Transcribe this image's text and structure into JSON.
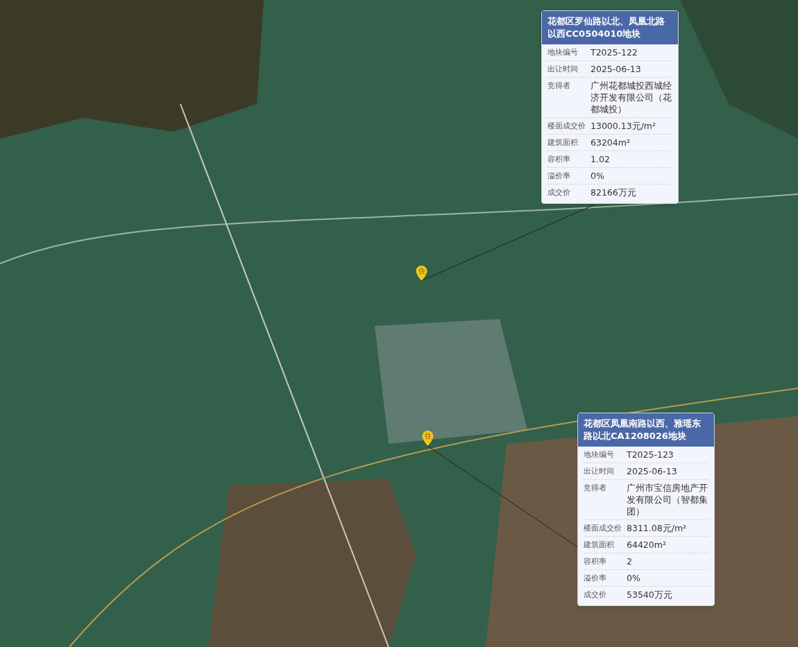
{
  "map": {
    "pins": [
      {
        "label": "住"
      },
      {
        "label": "住"
      }
    ]
  },
  "popups": [
    {
      "title": "花都区罗仙路以北、凤凰北路以西CC0504010地块",
      "fields": [
        {
          "label": "地块编号",
          "value": "T2025-122"
        },
        {
          "label": "出让时间",
          "value": "2025-06-13"
        },
        {
          "label": "竞得者",
          "value": "广州花都城投西城经济开发有限公司（花都城投）"
        },
        {
          "label": "楼面成交价",
          "value": "13000.13元/m²"
        },
        {
          "label": "建筑面积",
          "value": "63204m²"
        },
        {
          "label": "容积率",
          "value": "1.02"
        },
        {
          "label": "溢价率",
          "value": "0%"
        },
        {
          "label": "成交价",
          "value": "82166万元"
        }
      ]
    },
    {
      "title": "花都区凤凰南路以西、雅瑶东路以北CA1208026地块",
      "fields": [
        {
          "label": "地块编号",
          "value": "T2025-123"
        },
        {
          "label": "出让时间",
          "value": "2025-06-13"
        },
        {
          "label": "竞得者",
          "value": "广州市宝信房地产开发有限公司（智都集团）"
        },
        {
          "label": "楼面成交价",
          "value": "8311.08元/m²"
        },
        {
          "label": "建筑面积",
          "value": "64420m²"
        },
        {
          "label": "容积率",
          "value": "2"
        },
        {
          "label": "溢价率",
          "value": "0%"
        },
        {
          "label": "成交价",
          "value": "53540万元"
        }
      ]
    }
  ]
}
